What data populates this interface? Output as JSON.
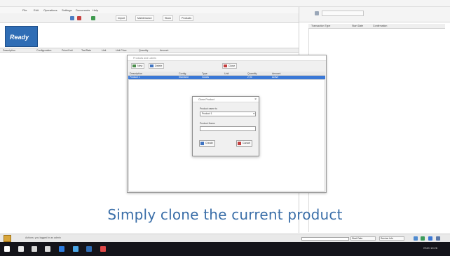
{
  "menubar": {
    "items": [
      "File",
      "Edit",
      "Operations",
      "Settings",
      "Documents",
      "Help"
    ]
  },
  "toolbar": {
    "buttons": [
      "Import",
      "Maintenance",
      "Stock",
      "Products"
    ]
  },
  "status_panel": {
    "label": "Ready"
  },
  "main_grid": {
    "columns": [
      "Description",
      "Configuration",
      "Price/Unit",
      "Tax/Rate",
      "Unit",
      "Unit Price",
      "Quantity",
      "Amount"
    ]
  },
  "right_pane": {
    "columns": [
      "Transaction Type",
      "Start Date",
      "Confirmation"
    ]
  },
  "product_window": {
    "title": "Products and Labels",
    "buttons": {
      "new": "New",
      "delete": "Delete",
      "close": "Close"
    },
    "grid_columns": [
      "Description",
      "Config",
      "Type",
      "Unit",
      "Quantity",
      "Amount",
      "Barcode"
    ],
    "selected_row": {
      "description": "Product 1",
      "config": "Standard",
      "type": "Goods",
      "amount": "2,90",
      "barcode": "Active"
    }
  },
  "clone_dialog": {
    "title": "Clone Product",
    "close_glyph": "×",
    "template_label": "Product name to",
    "template_value": "Product 1",
    "new_name_label": "Product Name",
    "new_name_value": "",
    "ok_label": "Create",
    "cancel_label": "Cancel"
  },
  "caption": "Simply clone the current product",
  "statusbar": {
    "message": "Actions: you logged in as admin",
    "progress": 0.0,
    "fields": [
      "Start Date",
      "Service Info"
    ]
  },
  "taskbar": {
    "tray_text": "ENG  10:26"
  },
  "colors": {
    "accent": "#2f6db5",
    "selection": "#3a78d6",
    "caption": "#3a6ea8",
    "taskbar": "#14141a"
  }
}
